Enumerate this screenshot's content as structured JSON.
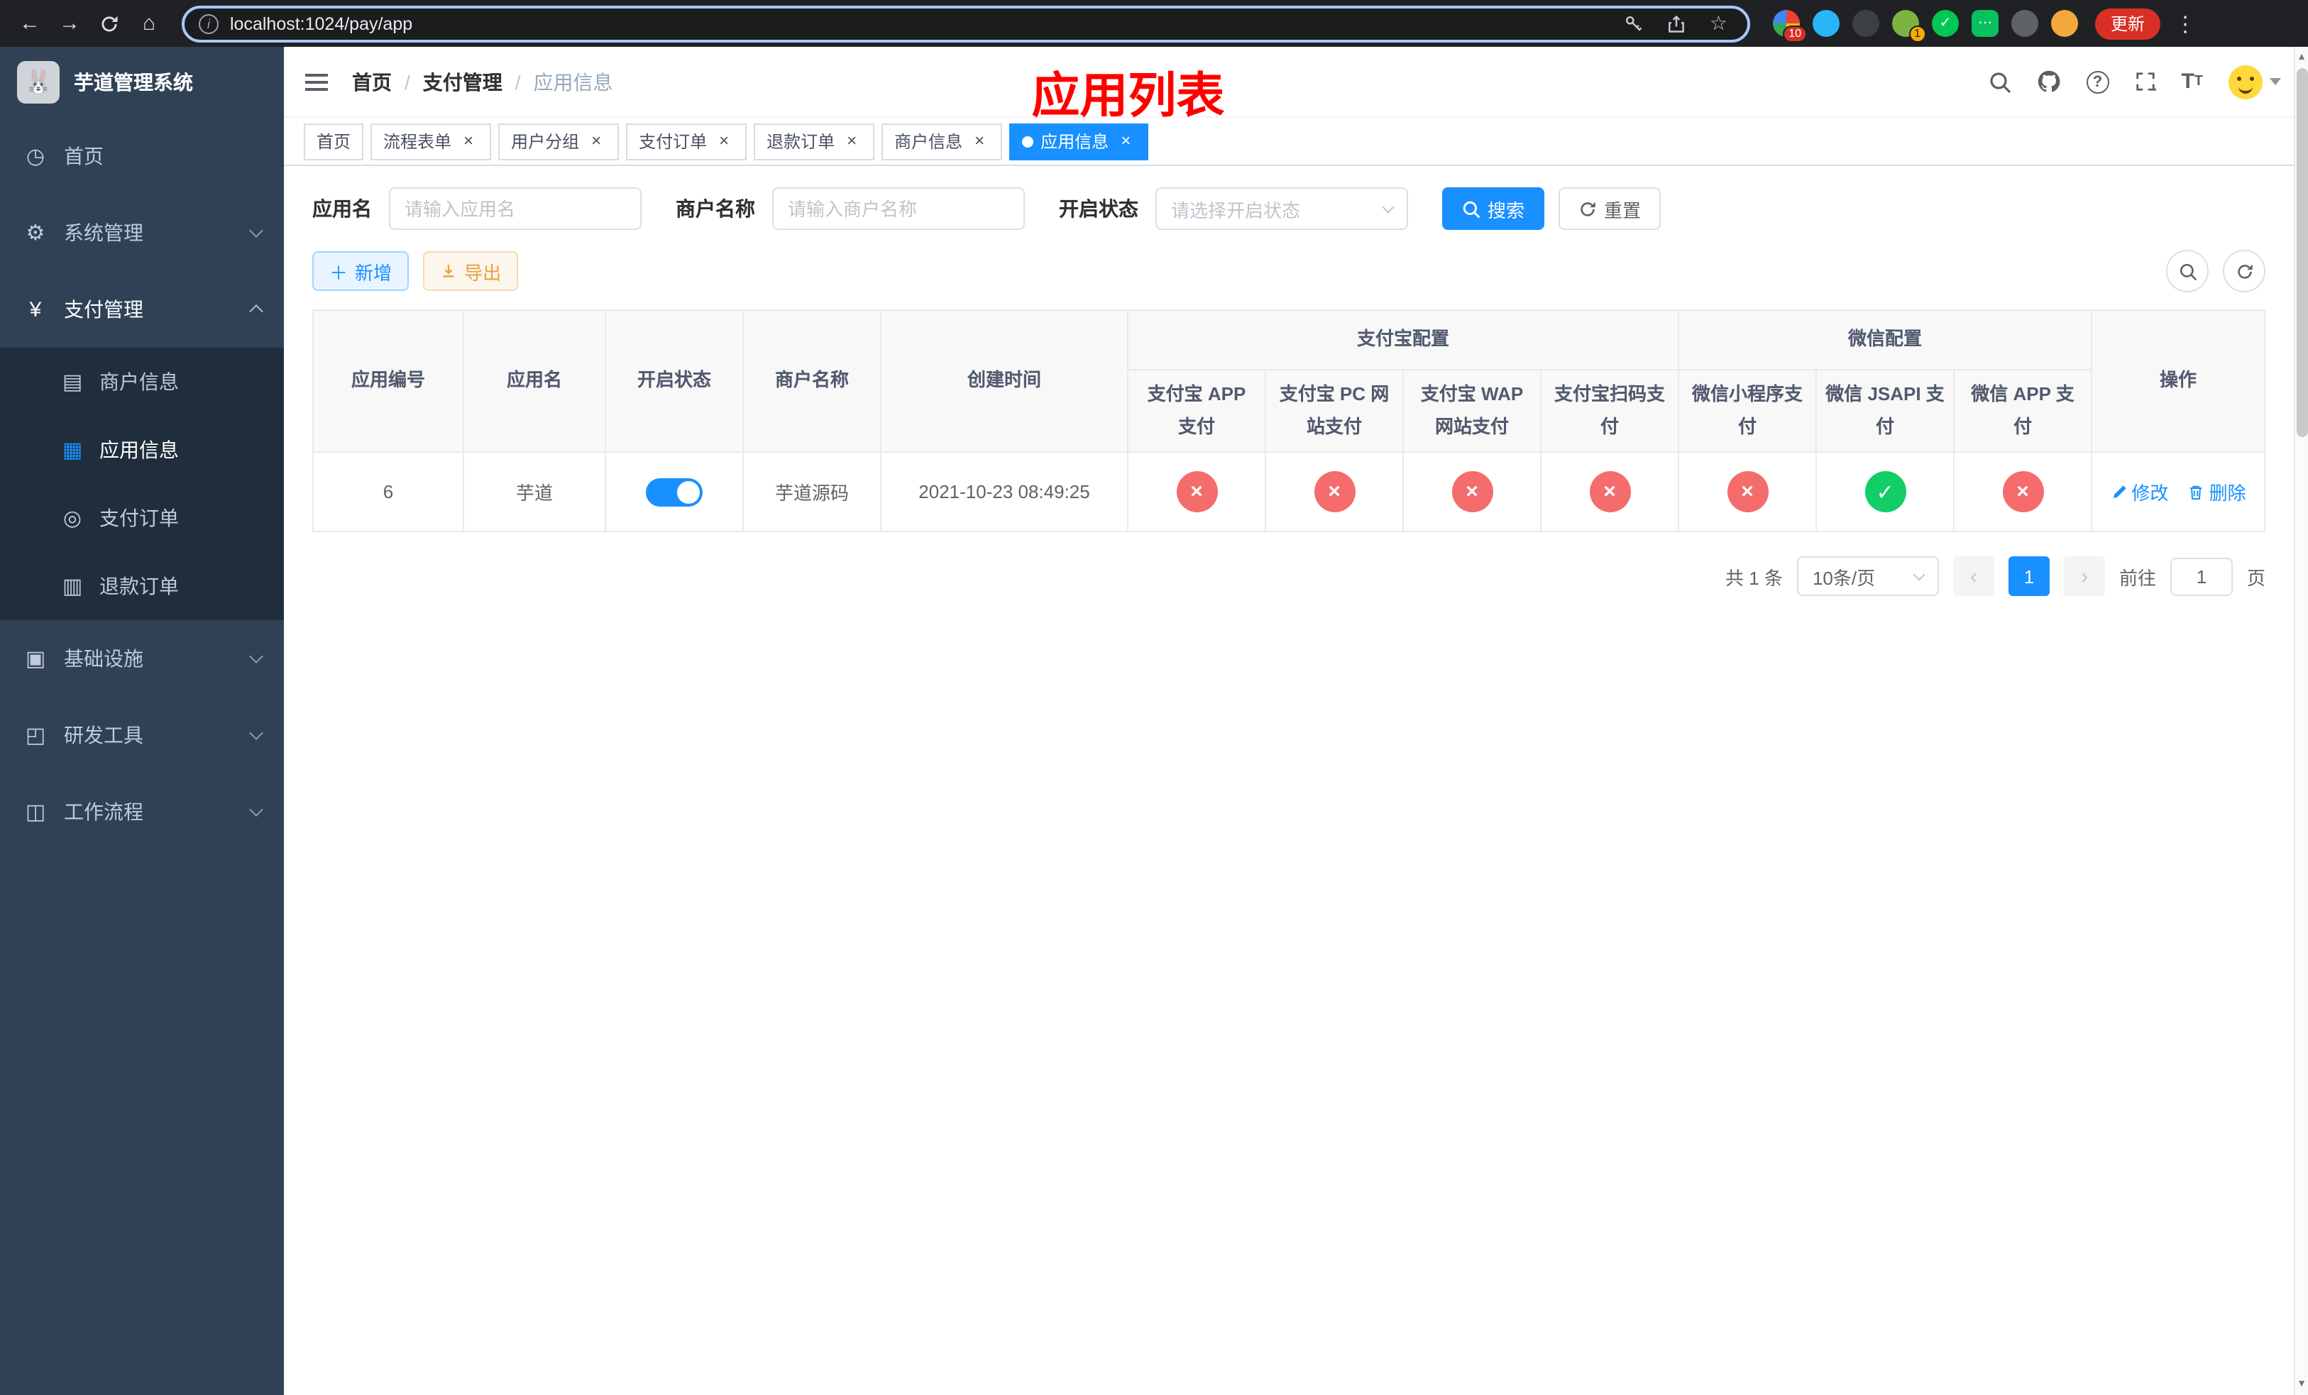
{
  "browser": {
    "url": "localhost:1024/pay/app",
    "update_label": "更新",
    "extension_badge": "10",
    "profile_badge": "1"
  },
  "sidebar": {
    "title": "芋道管理系统",
    "items": [
      {
        "label": "首页"
      },
      {
        "label": "系统管理"
      },
      {
        "label": "支付管理"
      },
      {
        "label": "商户信息"
      },
      {
        "label": "应用信息"
      },
      {
        "label": "支付订单"
      },
      {
        "label": "退款订单"
      },
      {
        "label": "基础设施"
      },
      {
        "label": "研发工具"
      },
      {
        "label": "工作流程"
      }
    ]
  },
  "navbar": {
    "breadcrumb": [
      "首页",
      "支付管理",
      "应用信息"
    ],
    "separator": "/",
    "annotation": "应用列表"
  },
  "tags": [
    {
      "label": "首页"
    },
    {
      "label": "流程表单"
    },
    {
      "label": "用户分组"
    },
    {
      "label": "支付订单"
    },
    {
      "label": "退款订单"
    },
    {
      "label": "商户信息"
    },
    {
      "label": "应用信息"
    }
  ],
  "close_glyph": "×",
  "filter": {
    "app_name_label": "应用名",
    "app_name_placeholder": "请输入应用名",
    "merchant_label": "商户名称",
    "merchant_placeholder": "请输入商户名称",
    "status_label": "开启状态",
    "status_placeholder": "请选择开启状态",
    "search_label": "搜索",
    "reset_label": "重置"
  },
  "toolbar": {
    "add_label": "新增",
    "export_label": "导出"
  },
  "table": {
    "columns": [
      "应用编号",
      "应用名",
      "开启状态",
      "商户名称",
      "创建时间"
    ],
    "groups": [
      {
        "label": "支付宝配置",
        "children": [
          "支付宝 APP 支付",
          "支付宝 PC 网站支付",
          "支付宝 WAP 网站支付",
          "支付宝扫码支付"
        ]
      },
      {
        "label": "微信配置",
        "children": [
          "微信小程序支付",
          "微信 JSAPI 支付",
          "微信 APP 支付"
        ]
      }
    ],
    "op_column": "操作",
    "icons": {
      "success": "✓",
      "fail": "×"
    },
    "row": {
      "app_id": "6",
      "app_name": "芋道",
      "enabled": true,
      "merchant_name": "芋道源码",
      "create_time": "2021-10-23 08:49:25",
      "pay_configs": [
        "fail",
        "fail",
        "fail",
        "fail",
        "fail",
        "success",
        "fail"
      ],
      "edit_label": "修改",
      "delete_label": "删除"
    }
  },
  "pagination": {
    "total": "共 1 条",
    "page_size": "10条/页",
    "prev_glyph": "‹",
    "next_glyph": "›",
    "current_page": "1",
    "goto_prefix": "前往",
    "goto_value": "1",
    "goto_suffix": "页"
  }
}
